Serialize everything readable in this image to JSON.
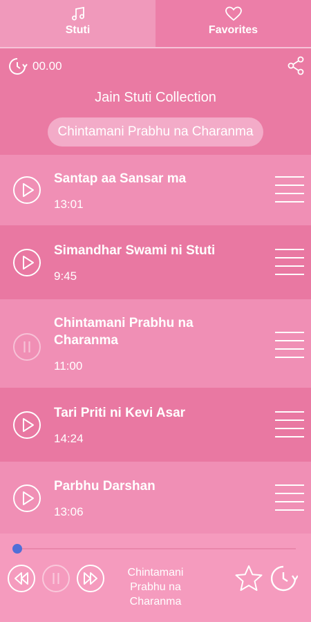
{
  "tabs": [
    {
      "label": "Stuti",
      "icon": "music-note-icon",
      "active": true
    },
    {
      "label": "Favorites",
      "icon": "heart-icon",
      "active": false
    }
  ],
  "timer": {
    "value": "00.00"
  },
  "collection": {
    "title": "Jain Stuti Collection",
    "now_playing": "Chintamani Prabhu na Charanma"
  },
  "tracks": [
    {
      "title": "Santap aa Sansar ma",
      "duration": "13:01",
      "state": "play"
    },
    {
      "title": "Simandhar Swami ni Stuti",
      "duration": "9:45",
      "state": "play"
    },
    {
      "title": "Chintamani Prabhu na Charanma",
      "duration": "11:00",
      "state": "paused-current"
    },
    {
      "title": "Tari Priti ni Kevi Asar",
      "duration": "14:24",
      "state": "play"
    },
    {
      "title": "Parbhu Darshan",
      "duration": "13:06",
      "state": "play"
    }
  ],
  "player": {
    "now_title": "Chintamani Prabhu na Charanma",
    "progress": 0.0
  },
  "colors": {
    "background": "#ea7aa3",
    "accent": "#4f6fd8"
  }
}
